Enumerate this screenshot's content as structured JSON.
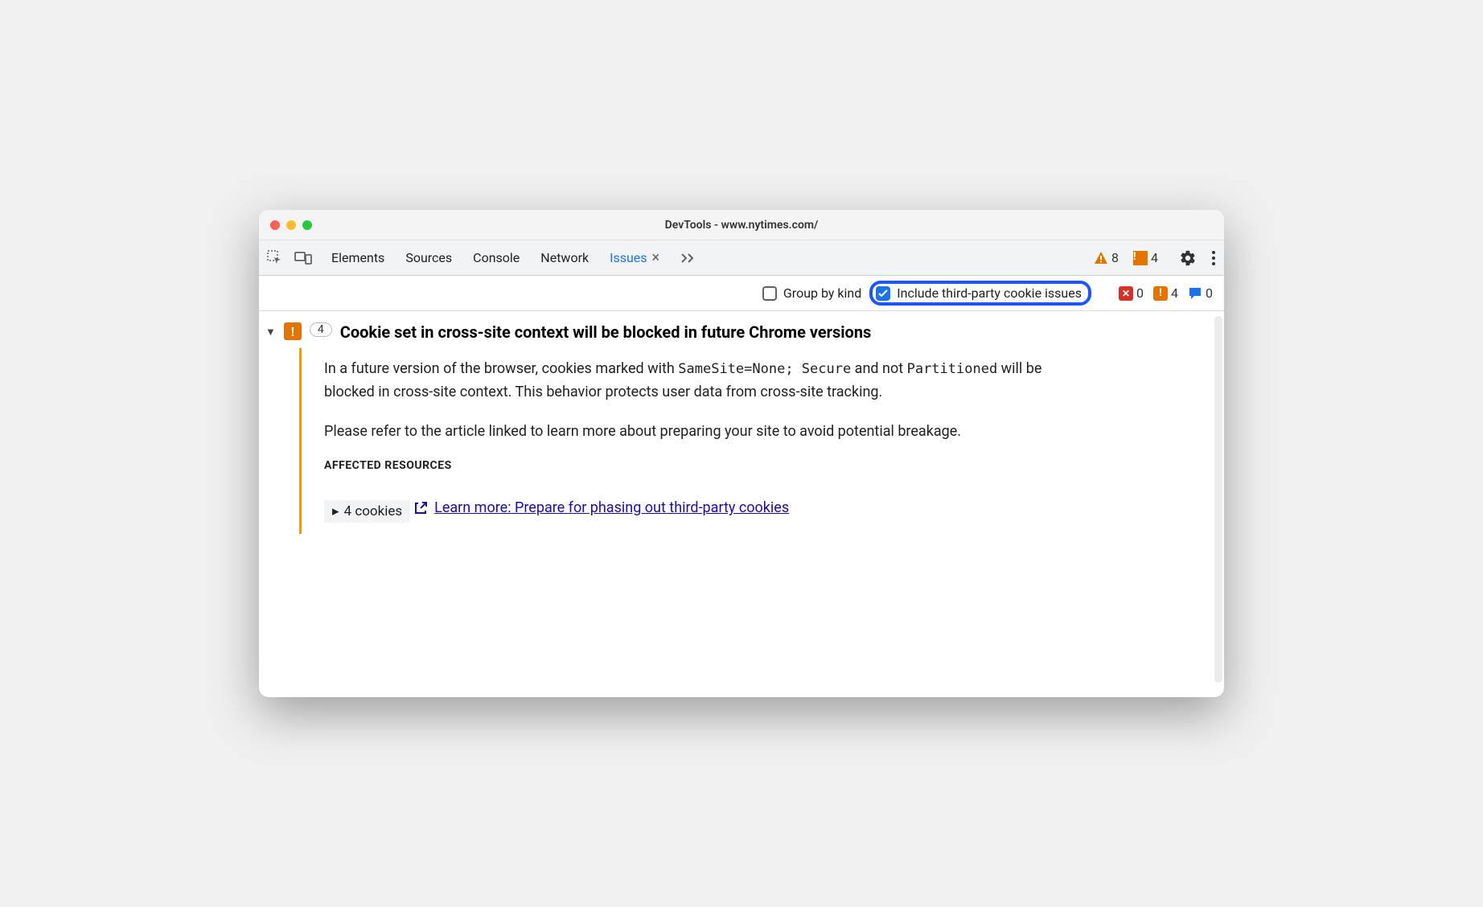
{
  "window": {
    "title": "DevTools - www.nytimes.com/"
  },
  "tabs": {
    "items": [
      "Elements",
      "Sources",
      "Console",
      "Network",
      "Issues"
    ],
    "active": "Issues"
  },
  "toolbar_badges": {
    "error_count": "8",
    "warn_count": "4"
  },
  "filter": {
    "group_by_kind": {
      "label": "Group by kind",
      "checked": false
    },
    "include_third_party": {
      "label": "Include third-party cookie issues",
      "checked": true
    }
  },
  "filter_badges": {
    "blocked": "0",
    "warn": "4",
    "info": "0"
  },
  "issue": {
    "count": "4",
    "title": "Cookie set in cross-site context will be blocked in future Chrome versions",
    "p1_a": "In a future version of the browser, cookies marked with ",
    "code1": "SameSite=None; Secure",
    "p1_b": " and not ",
    "code2": "Partitioned",
    "p1_c": " will be blocked in cross-site context. This behavior protects user data from cross-site tracking.",
    "p2": "Please refer to the article linked to learn more about preparing your site to avoid potential breakage.",
    "affected_label": "AFFECTED RESOURCES",
    "affected_item": "4 cookies",
    "learn_more": "Learn more: Prepare for phasing out third-party cookies"
  }
}
